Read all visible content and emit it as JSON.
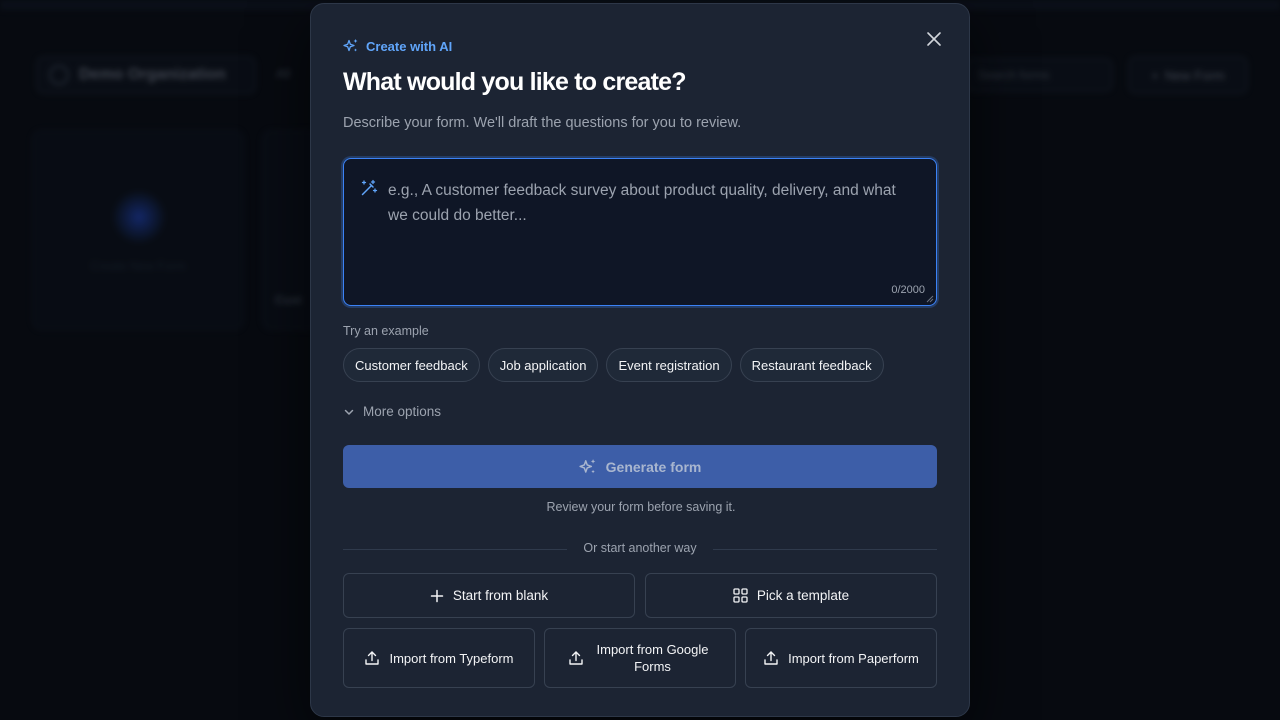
{
  "background": {
    "org_name": "Demo Organization",
    "breadcrumb": "All",
    "search_placeholder": "Search forms",
    "new_form_label": "New Form",
    "card_label": "Create New Form",
    "card2_title": "Cust"
  },
  "modal": {
    "eyebrow": "Create with AI",
    "title": "What would you like to create?",
    "subtitle": "Describe your form. We'll draft the questions for you to review.",
    "prompt": {
      "placeholder": "e.g., A customer feedback survey about product quality, delivery, and what we could do better...",
      "value": "",
      "char_count": "0/2000"
    },
    "examples_label": "Try an example",
    "examples": [
      "Customer feedback",
      "Job application",
      "Event registration",
      "Restaurant feedback"
    ],
    "more_options_label": "More options",
    "generate_label": "Generate form",
    "review_note": "Review your form before saving it.",
    "divider_text": "Or start another way",
    "start_blank_label": "Start from blank",
    "pick_template_label": "Pick a template",
    "import_typeform_label": "Import from Typeform",
    "import_google_forms_label": "Import from Google Forms",
    "import_paperform_label": "Import from Paperform"
  },
  "colors": {
    "accent": "#3b82f6",
    "eyebrow": "#60a5fa",
    "generate_button": "#3d5ea8",
    "modal_bg": "#1c2433",
    "page_bg": "#070a10"
  },
  "icons": {
    "eyebrow": "sparkles-icon",
    "close": "close-icon",
    "prompt": "magic-wand-icon",
    "more_options": "chevron-down-icon",
    "generate": "sparkles-icon",
    "blank": "plus-icon",
    "template": "grid-icon",
    "import": "upload-icon"
  }
}
